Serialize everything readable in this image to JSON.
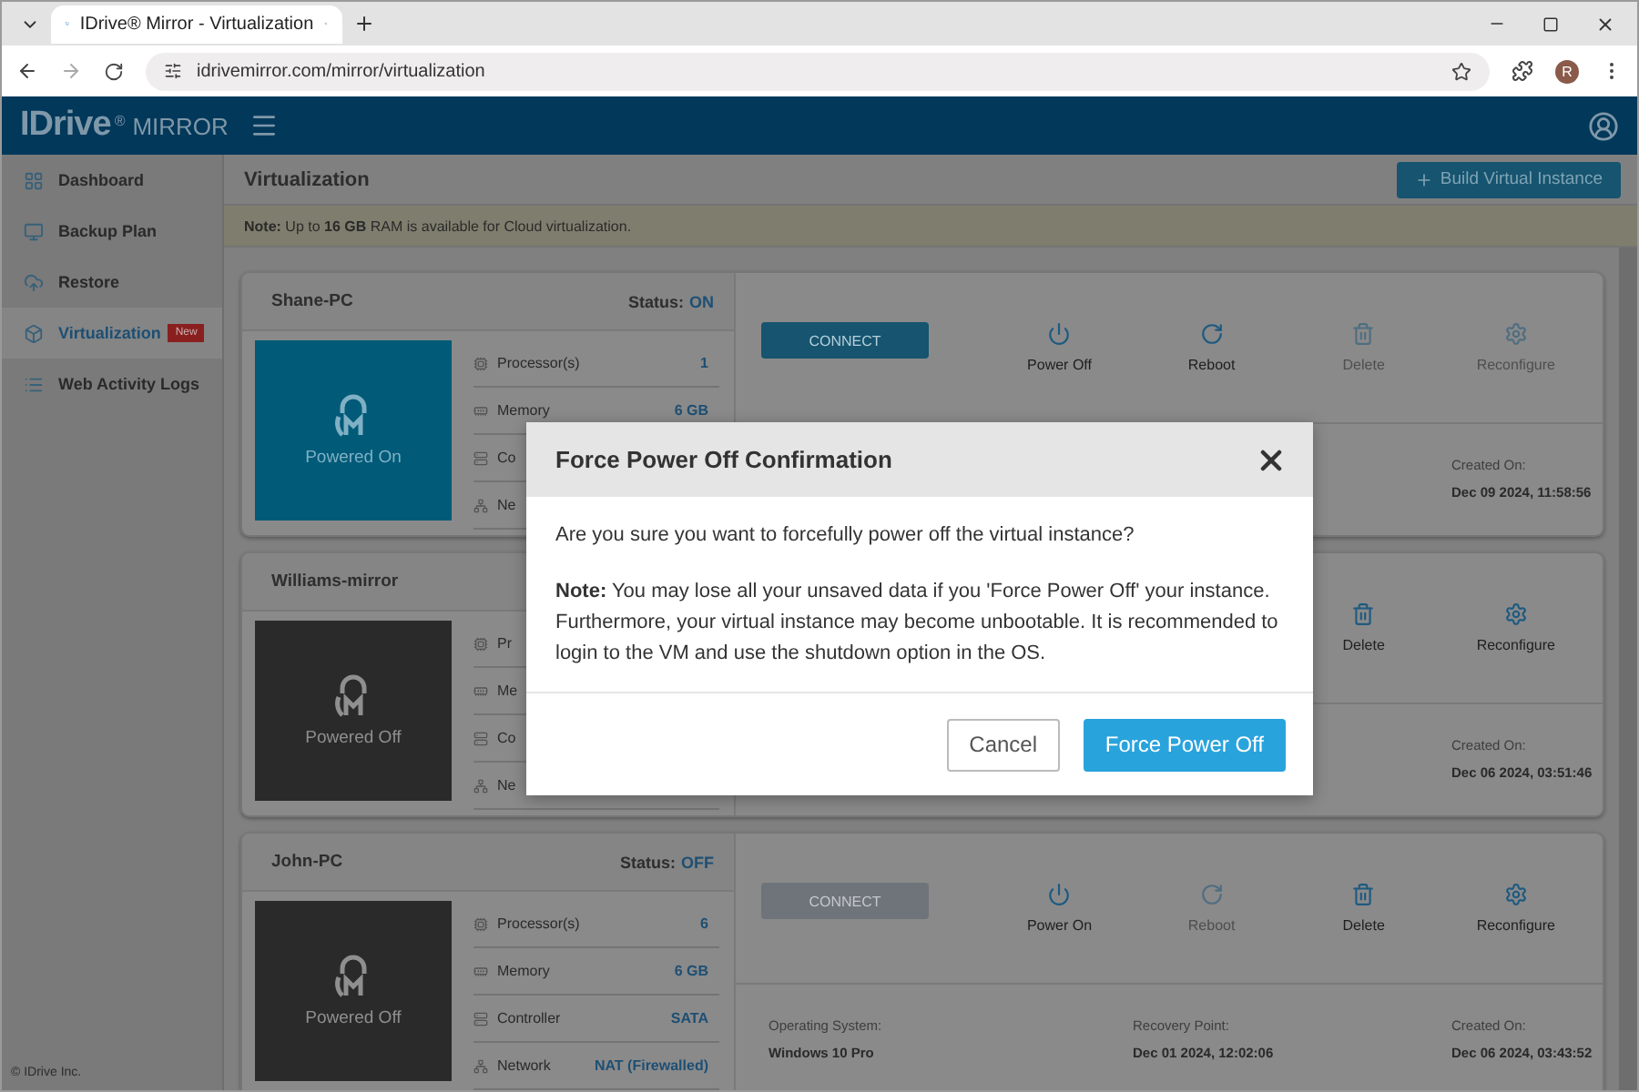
{
  "browser": {
    "tab_title": "IDrive® Mirror - Virtualization",
    "url": "idrivemirror.com/mirror/virtualization",
    "profile_initial": "R"
  },
  "app": {
    "brand": "IDrive",
    "registered": "®",
    "product": "MIRROR"
  },
  "sidebar": {
    "items": [
      {
        "label": "Dashboard",
        "selected": false
      },
      {
        "label": "Backup Plan",
        "selected": false
      },
      {
        "label": "Restore",
        "selected": false
      },
      {
        "label": "Virtualization",
        "selected": true,
        "badge": "New"
      },
      {
        "label": "Web Activity Logs",
        "selected": false
      }
    ],
    "footer": "© IDrive Inc."
  },
  "page": {
    "title": "Virtualization",
    "build_button": "Build Virtual Instance",
    "note": "**Note:** Up to **16 GB** RAM is available for Cloud virtualization."
  },
  "vms": [
    {
      "name": "Shane-PC",
      "status_label": "Status:",
      "status": "ON",
      "powered_on": true,
      "tile_label": "Powered On",
      "specs": [
        {
          "label": "Processor(s)",
          "value": "1"
        },
        {
          "label": "Memory",
          "value": "6 GB"
        },
        {
          "label": "Co"
        },
        {
          "label": "Ne"
        }
      ],
      "connect": {
        "label": "CONNECT",
        "disabled": false
      },
      "actions": [
        {
          "kind": "power",
          "label": "Power Off",
          "disabled": false
        },
        {
          "kind": "reboot",
          "label": "Reboot",
          "disabled": false
        },
        {
          "kind": "delete",
          "label": "Delete",
          "disabled": true
        },
        {
          "kind": "settings",
          "label": "Reconfigure",
          "disabled": true
        }
      ],
      "info": [
        {
          "label": "Created On:",
          "value": "Dec 09 2024, 11:58:56"
        }
      ]
    },
    {
      "name": "Williams-mirror",
      "powered_on": false,
      "tile_label": "Powered Off",
      "specs": [
        {
          "label": "Pr"
        },
        {
          "label": "Me"
        },
        {
          "label": "Co"
        },
        {
          "label": "Ne"
        }
      ],
      "actions": [
        {
          "kind": "delete",
          "label": "Delete",
          "disabled": false
        },
        {
          "kind": "settings",
          "label": "Reconfigure",
          "disabled": false
        }
      ],
      "info": [
        {
          "label": "Created On:",
          "value": "Dec 06 2024, 03:51:46"
        }
      ]
    },
    {
      "name": "John-PC",
      "status_label": "Status:",
      "status": "OFF",
      "powered_on": false,
      "tile_label": "Powered Off",
      "specs": [
        {
          "label": "Processor(s)",
          "value": "6"
        },
        {
          "label": "Memory",
          "value": "6 GB"
        },
        {
          "label": "Controller",
          "value": "SATA"
        },
        {
          "label": "Network",
          "value": "NAT (Firewalled)"
        }
      ],
      "connect": {
        "label": "CONNECT",
        "disabled": true
      },
      "actions": [
        {
          "kind": "power",
          "label": "Power On",
          "disabled": false
        },
        {
          "kind": "reboot",
          "label": "Reboot",
          "disabled": true
        },
        {
          "kind": "delete",
          "label": "Delete",
          "disabled": false
        },
        {
          "kind": "settings",
          "label": "Reconfigure",
          "disabled": false
        }
      ],
      "info": [
        {
          "label": "Operating System:",
          "value": "Windows 10 Pro"
        },
        {
          "label": "Recovery Point:",
          "value": "Dec 01 2024, 12:02:06"
        },
        {
          "label": "Created On:",
          "value": "Dec 06 2024, 03:43:52"
        }
      ]
    }
  ],
  "dialog": {
    "title": "Force Power Off Confirmation",
    "question": "Are you sure you want to forcefully power off the virtual instance?",
    "note": "**Note:** You may lose all your unsaved data if you 'Force Power Off' your instance. Furthermore, your virtual instance may become unbootable. It is recommended to login to the VM and use the shutdown option in the OS.",
    "cancel": "Cancel",
    "confirm": "Force Power Off"
  }
}
